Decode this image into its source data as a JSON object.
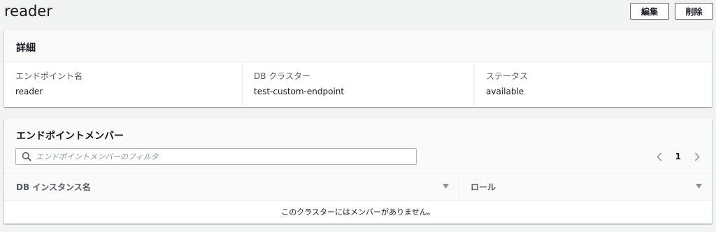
{
  "page": {
    "title": "reader"
  },
  "actions": {
    "edit_label": "編集",
    "delete_label": "削除"
  },
  "details": {
    "heading": "詳細",
    "fields": [
      {
        "label": "エンドポイント名",
        "value": "reader"
      },
      {
        "label": "DB クラスター",
        "value": "test-custom-endpoint"
      },
      {
        "label": "ステータス",
        "value": "available"
      }
    ]
  },
  "members": {
    "heading": "エンドポイントメンバー",
    "search": {
      "value": "",
      "placeholder": "エンドポイントメンバーのフィルタ",
      "icon": "search-icon"
    },
    "pager": {
      "current_page": "1",
      "prev_icon": "chevron-left-icon",
      "next_icon": "chevron-right-icon"
    },
    "table": {
      "columns": [
        {
          "label": "DB インスタンス名",
          "sort_icon": "caret-down-icon"
        },
        {
          "label": "ロール",
          "sort_icon": "caret-down-icon"
        }
      ],
      "empty_message": "このクラスターにはメンバーがありません。"
    }
  }
}
